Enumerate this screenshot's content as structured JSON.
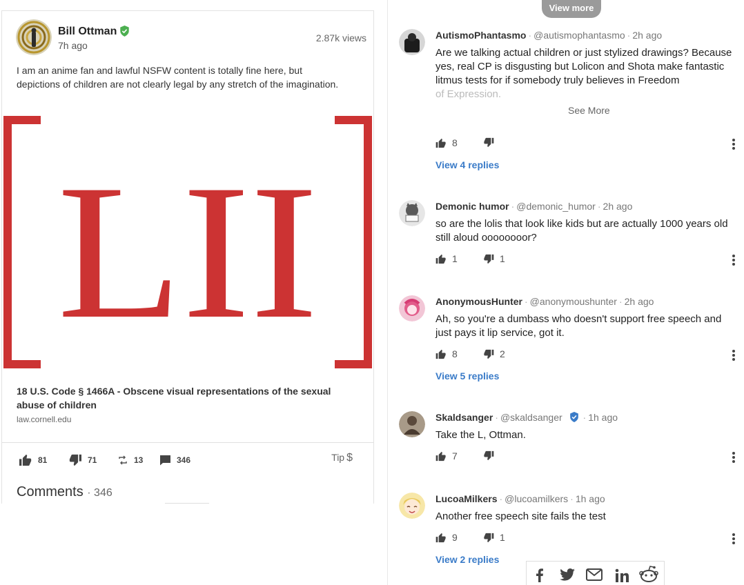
{
  "post": {
    "author": "Bill Ottman",
    "time": "7h ago",
    "views": "2.87k views",
    "text": "I am an anime fan and lawful NSFW content is totally fine here, but depictions of children are not clearly legal by any stretch of the imagination.",
    "link": {
      "image_text": "LII",
      "title": "18 U.S. Code § 1466A - Obscene visual representations of the sexual abuse of children",
      "domain": "law.cornell.edu"
    },
    "actions": {
      "upvotes": "81",
      "downvotes": "71",
      "reminds": "13",
      "comments": "346",
      "tip_label": "Tip"
    },
    "comments_heading": "Comments",
    "comments_count": "346",
    "colors": {
      "verified": "#4caf50",
      "lii_red": "#cc3333"
    }
  },
  "sidebar": {
    "view_more_label": "View more",
    "see_more_label": "See More",
    "link_color": "#3a7bc8",
    "comments": [
      {
        "user": "AutismoPhantasmo",
        "handle": "@autismophantasmo",
        "time": "2h ago",
        "text": "Are we talking actual children or just stylized drawings? Because yes, real CP is disgusting but Lolicon and Shota make fantastic litmus tests for if somebody truly believes in Freedom",
        "text_faded": "of Expression.",
        "upvotes": "8",
        "downvotes": "",
        "replies": "View 4 replies"
      },
      {
        "user": "Demonic humor",
        "handle": "@demonic_humor",
        "time": "2h ago",
        "text": "so are the lolis that look like kids but are actually 1000 years old still aloud oooooooor?",
        "upvotes": "1",
        "downvotes": "1"
      },
      {
        "user": "AnonymousHunter",
        "handle": "@anonymoushunter",
        "time": "2h ago",
        "text": "Ah, so you're a dumbass who doesn't support free speech and just pays it lip service, got it.",
        "upvotes": "8",
        "downvotes": "2",
        "replies": "View 5 replies"
      },
      {
        "user": "Skaldsanger",
        "handle": "@skaldsanger",
        "time": "1h ago",
        "text": "Take the L, Ottman.",
        "upvotes": "7",
        "downvotes": ""
      },
      {
        "user": "LucoaMilkers",
        "handle": "@lucoamilkers",
        "time": "1h ago",
        "text": "Another free speech site fails the test",
        "upvotes": "9",
        "downvotes": "1",
        "replies": "View 2 replies"
      }
    ]
  },
  "share_icons": [
    "facebook-icon",
    "twitter-icon",
    "email-icon",
    "linkedin-icon",
    "reddit-icon"
  ]
}
